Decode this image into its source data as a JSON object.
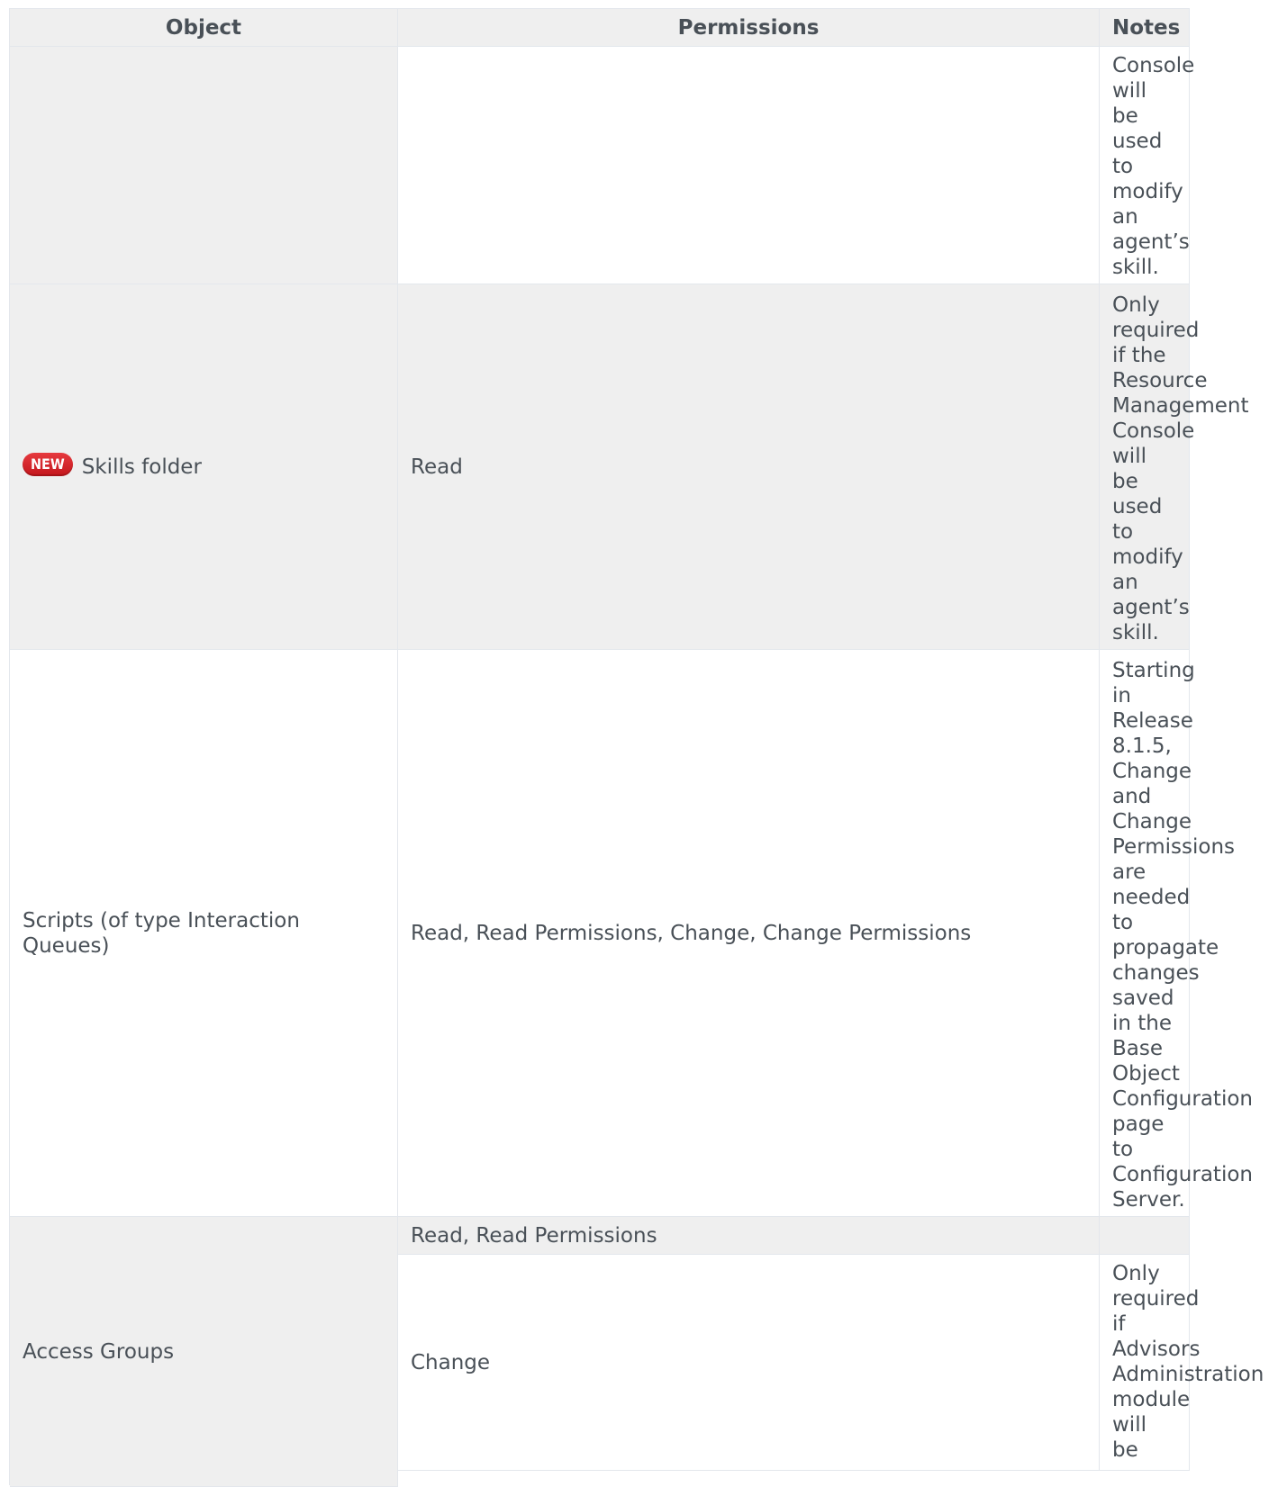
{
  "table": {
    "headers": {
      "object": "Object",
      "permissions": "Permissions",
      "notes": "Notes"
    },
    "rows": [
      {
        "object": "",
        "permissions": "",
        "notes_words": [
          "Console",
          "will",
          "be",
          "used",
          "to",
          "modify",
          "an",
          "agent’s",
          "skill."
        ]
      },
      {
        "badge": "NEW",
        "object": "Skills folder",
        "permissions": "Read",
        "notes_words": [
          "Only",
          "required",
          "if the",
          "Resource",
          "Management",
          "Console",
          "will",
          "be",
          "used",
          "to",
          "modify",
          "an",
          "agent’s",
          "skill."
        ]
      },
      {
        "object": "Scripts (of type Interaction Queues)",
        "permissions": "Read, Read Permissions, Change, Change Permissions",
        "notes_words": [
          "Starting",
          "in",
          "Release",
          "8.1.5,",
          "Change",
          "and",
          "Change",
          "Permissions",
          "are",
          "needed",
          "to",
          "propagate",
          "changes",
          "saved",
          "in the",
          "Base",
          "Object",
          "Configuration",
          "page",
          "to",
          "Configuration",
          "Server."
        ]
      },
      {
        "object": "Access Groups",
        "sub_rows": [
          {
            "permissions": "Read, Read Permissions",
            "notes_words": []
          },
          {
            "permissions": "Change",
            "notes_words": [
              "Only",
              "required",
              "if",
              "Advisors",
              "Administration",
              "module",
              "will",
              "be"
            ]
          }
        ]
      }
    ]
  }
}
